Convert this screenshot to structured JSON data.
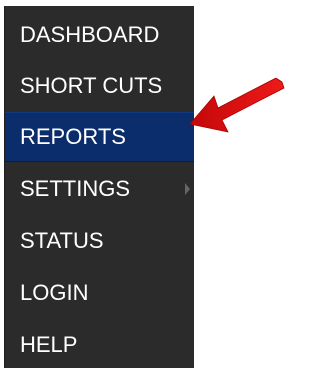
{
  "menu": {
    "items": [
      {
        "label": "DASHBOARD",
        "active": false,
        "has_submenu": false
      },
      {
        "label": "SHORT CUTS",
        "active": false,
        "has_submenu": false
      },
      {
        "label": "REPORTS",
        "active": true,
        "has_submenu": false
      },
      {
        "label": "SETTINGS",
        "active": false,
        "has_submenu": true
      },
      {
        "label": "STATUS",
        "active": false,
        "has_submenu": false
      },
      {
        "label": "LOGIN",
        "active": false,
        "has_submenu": false
      },
      {
        "label": "HELP",
        "active": false,
        "has_submenu": false
      }
    ]
  },
  "colors": {
    "menu_background": "#2b2b2b",
    "active_background": "#0b2d6b",
    "text": "#ffffff",
    "annotation_arrow": "#e01010"
  },
  "icons": {
    "submenu_indicator": "chevron-right-icon",
    "annotation": "red-pointer-arrow-icon"
  }
}
